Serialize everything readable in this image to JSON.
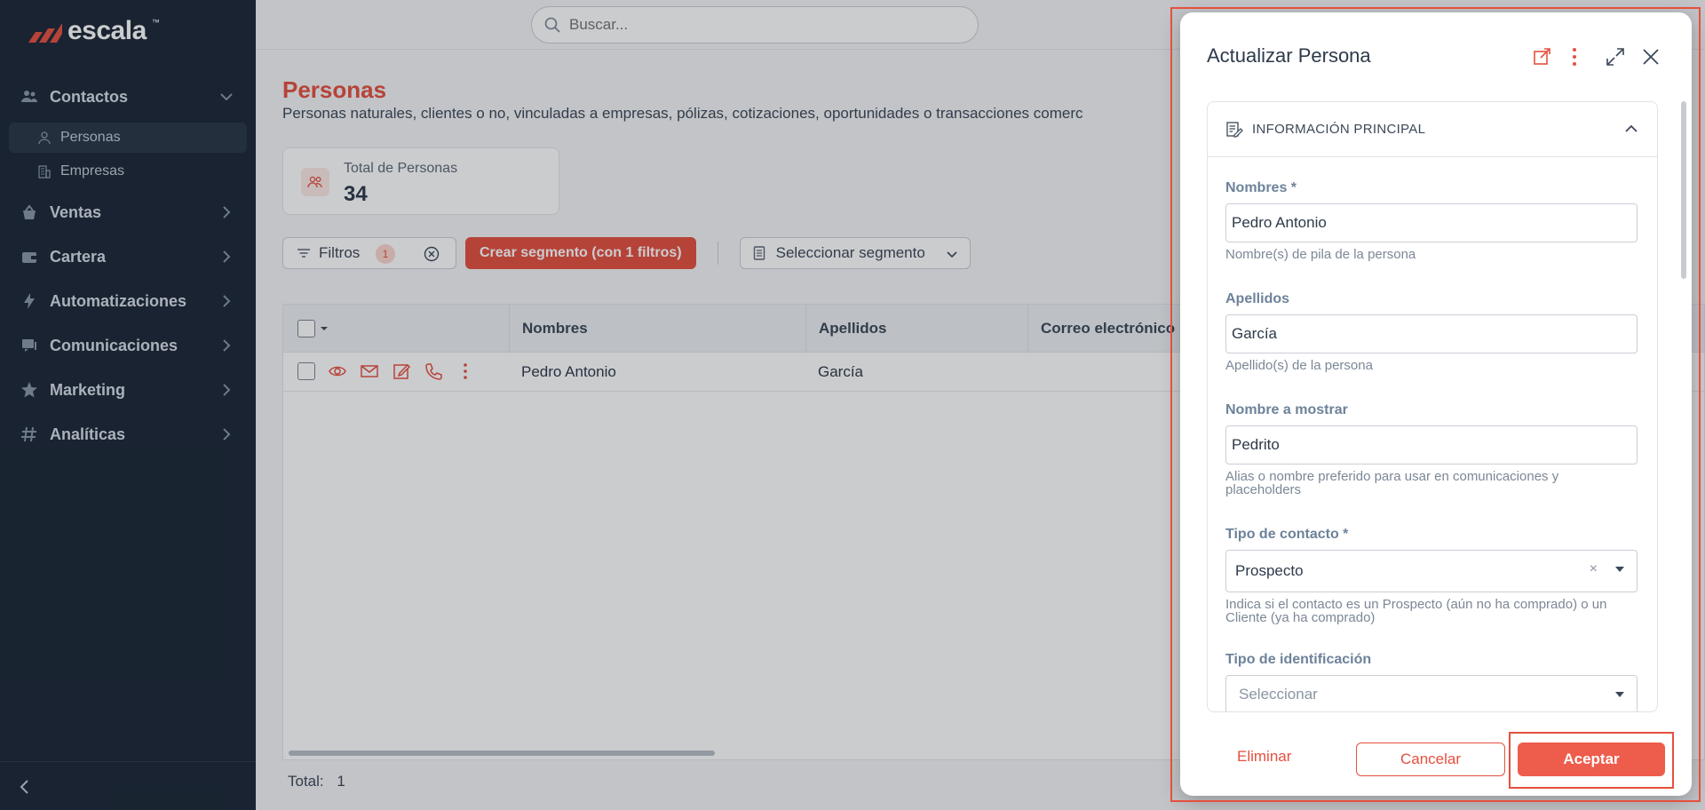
{
  "app": {
    "logo_text": "escala"
  },
  "search": {
    "placeholder": "Buscar..."
  },
  "sidebar": {
    "groups": [
      {
        "label": "Contactos",
        "icon": "contacts-icon",
        "expanded": true
      },
      {
        "label": "Ventas",
        "icon": "sales-icon"
      },
      {
        "label": "Cartera",
        "icon": "wallet-icon"
      },
      {
        "label": "Automatizaciones",
        "icon": "bolt-icon"
      },
      {
        "label": "Comunicaciones",
        "icon": "chat-icon"
      },
      {
        "label": "Marketing",
        "icon": "star-icon"
      },
      {
        "label": "Analíticas",
        "icon": "hash-icon"
      }
    ],
    "subitems": [
      {
        "label": "Personas",
        "icon": "person-icon",
        "active": true
      },
      {
        "label": "Empresas",
        "icon": "building-icon"
      }
    ]
  },
  "page": {
    "title": "Personas",
    "description": "Personas naturales, clientes o no, vinculadas a empresas, pólizas, cotizaciones, oportunidades o transacciones comerc",
    "stat": {
      "label": "Total de Personas",
      "value": "34"
    }
  },
  "filters": {
    "filtros_label": "Filtros",
    "filter_count": "1",
    "create_segment_label": "Crear segmento (con 1 filtros)",
    "select_segment_label": "Seleccionar segmento"
  },
  "table": {
    "columns": [
      "Nombres",
      "Apellidos",
      "Correo electrónico"
    ],
    "rows": [
      {
        "nombres": "Pedro Antonio",
        "apellidos": "García",
        "correo": ""
      }
    ],
    "total_label": "Total:",
    "total_value": "1"
  },
  "modal": {
    "title": "Actualizar Persona",
    "section_title": "INFORMACIÓN PRINCIPAL",
    "fields": {
      "nombres": {
        "label": "Nombres *",
        "value": "Pedro Antonio",
        "hint": "Nombre(s) de pila de la persona"
      },
      "apellidos": {
        "label": "Apellidos",
        "value": "García",
        "hint": "Apellido(s) de la persona"
      },
      "nombre_mostrar": {
        "label": "Nombre a mostrar",
        "value": "Pedrito",
        "hint": "Alias o nombre preferido para usar en comunicaciones y placeholders"
      },
      "tipo_contacto": {
        "label": "Tipo de contacto *",
        "value": "Prospecto",
        "clear": "×",
        "hint": "Indica si el contacto es un Prospecto (aún no ha comprado) o un Cliente (ya ha comprado)"
      },
      "tipo_identificacion": {
        "label": "Tipo de identificación",
        "placeholder": "Seleccionar"
      }
    },
    "buttons": {
      "eliminar": "Eliminar",
      "cancelar": "Cancelar",
      "aceptar": "Aceptar"
    }
  },
  "colors": {
    "accent": "#e5503f",
    "sidebar_bg": "#1b2736",
    "label": "#6d829a"
  }
}
